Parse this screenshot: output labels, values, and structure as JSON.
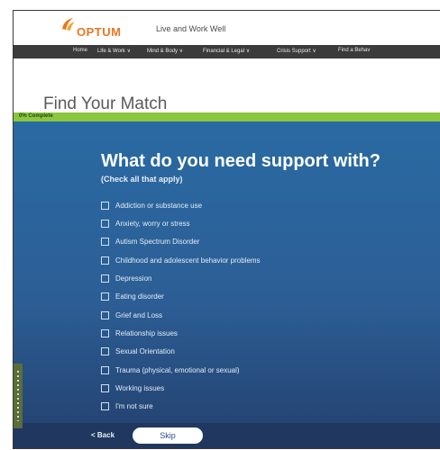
{
  "header": {
    "brand": "OPTUM",
    "tagline": "Live and Work Well"
  },
  "nav": {
    "items": [
      "Home",
      "Life & Work ∨",
      "Mind & Body ∨",
      "Financial & Legal ∨",
      "Crisis Support ∨",
      "Find a Behav"
    ]
  },
  "page": {
    "title": "Find Your Match"
  },
  "progress": {
    "label": "0% Complete",
    "percent": 0
  },
  "question": {
    "text": "What do you need support with?",
    "hint": "(Check all that apply)"
  },
  "options": [
    {
      "label": "Addiction or substance use"
    },
    {
      "label": "Anxiety, worry or stress"
    },
    {
      "label": "Autism Spectrum Disorder"
    },
    {
      "label": "Childhood and adolescent behavior problems"
    },
    {
      "label": "Depression"
    },
    {
      "label": "Eating disorder"
    },
    {
      "label": "Grief and Loss"
    },
    {
      "label": "Relationship issues"
    },
    {
      "label": "Sexual Orientation"
    },
    {
      "label": "Trauma (physical, emotional or sexual)"
    },
    {
      "label": "Working issues"
    },
    {
      "label": "I'm not sure"
    }
  ],
  "footer": {
    "back_label": "< Back",
    "skip_label": "Skip"
  },
  "colors": {
    "brand_orange": "#e87722",
    "progress_green": "#8cc63f",
    "panel_blue": "#2a6aa3",
    "nav_dark": "#3b3b3b"
  }
}
